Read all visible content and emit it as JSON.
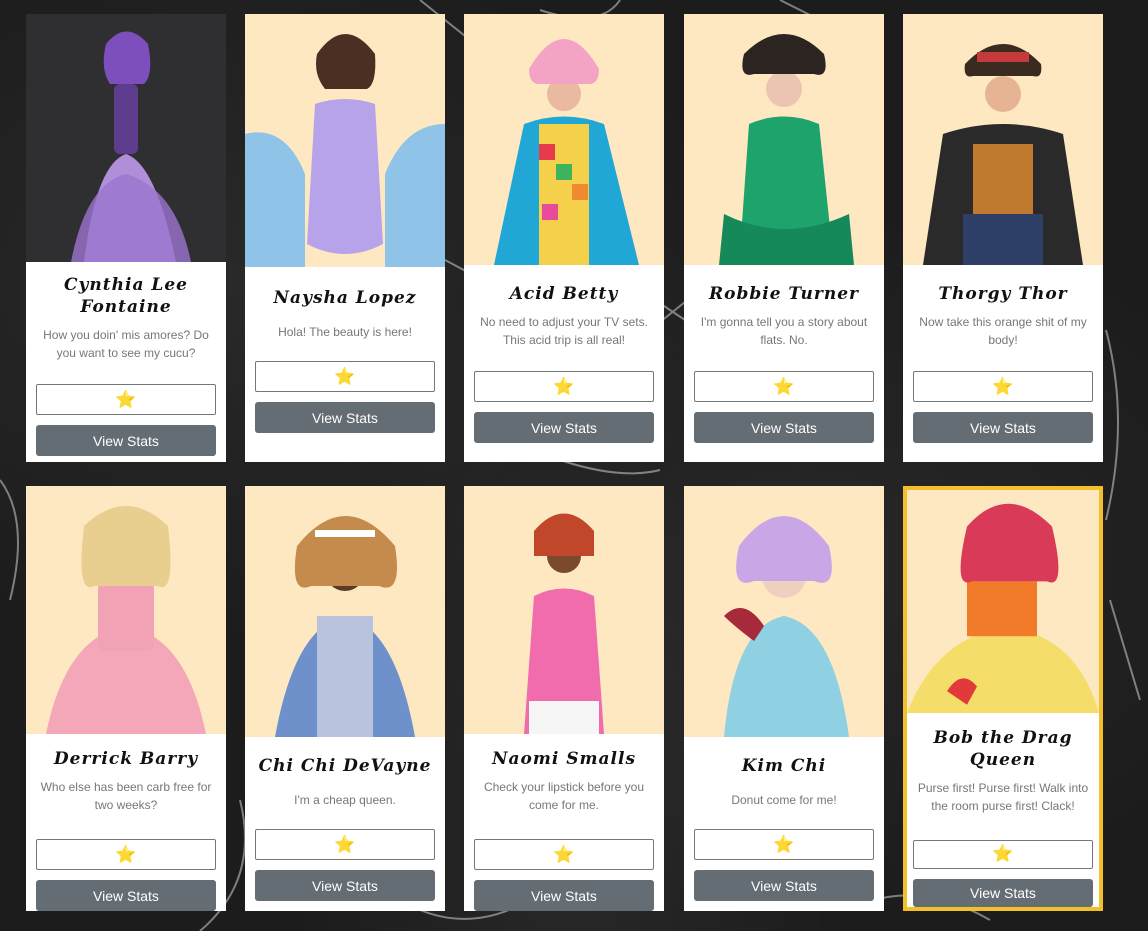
{
  "star_icon": "star-icon",
  "colors": {
    "button": "#656d74",
    "featured_border": "#f3c02c",
    "photo_bg": "#fde8c2"
  },
  "queens": [
    {
      "name": "Cynthia Lee Fontaine",
      "quote": "How you doin' mis amores? Do you want to see my cucu?",
      "rating": "⭐",
      "button": "View Stats"
    },
    {
      "name": "Naysha Lopez",
      "quote": "Hola! The beauty is here!",
      "rating": "⭐",
      "button": "View Stats"
    },
    {
      "name": "Acid Betty",
      "quote": "No need to adjust your TV sets. This acid trip is all real!",
      "rating": "⭐",
      "button": "View Stats"
    },
    {
      "name": "Robbie Turner",
      "quote": "I'm gonna tell you a story about flats. No.",
      "rating": "⭐",
      "button": "View Stats"
    },
    {
      "name": "Thorgy Thor",
      "quote": "Now take this orange shit of my body!",
      "rating": "⭐",
      "button": "View Stats"
    },
    {
      "name": "Derrick Barry",
      "quote": "Who else has been carb free for two weeks?",
      "rating": "⭐",
      "button": "View Stats"
    },
    {
      "name": "Chi Chi DeVayne",
      "quote": "I'm a cheap queen.",
      "rating": "⭐",
      "button": "View Stats"
    },
    {
      "name": "Naomi Smalls",
      "quote": "Check your lipstick before you come for me.",
      "rating": "⭐",
      "button": "View Stats"
    },
    {
      "name": "Kim Chi",
      "quote": "Donut come for me!",
      "rating": "⭐",
      "button": "View Stats"
    },
    {
      "name": "Bob the Drag Queen",
      "quote": "Purse first! Purse first! Walk into the room purse first! Clack!",
      "rating": "⭐",
      "button": "View Stats"
    }
  ]
}
